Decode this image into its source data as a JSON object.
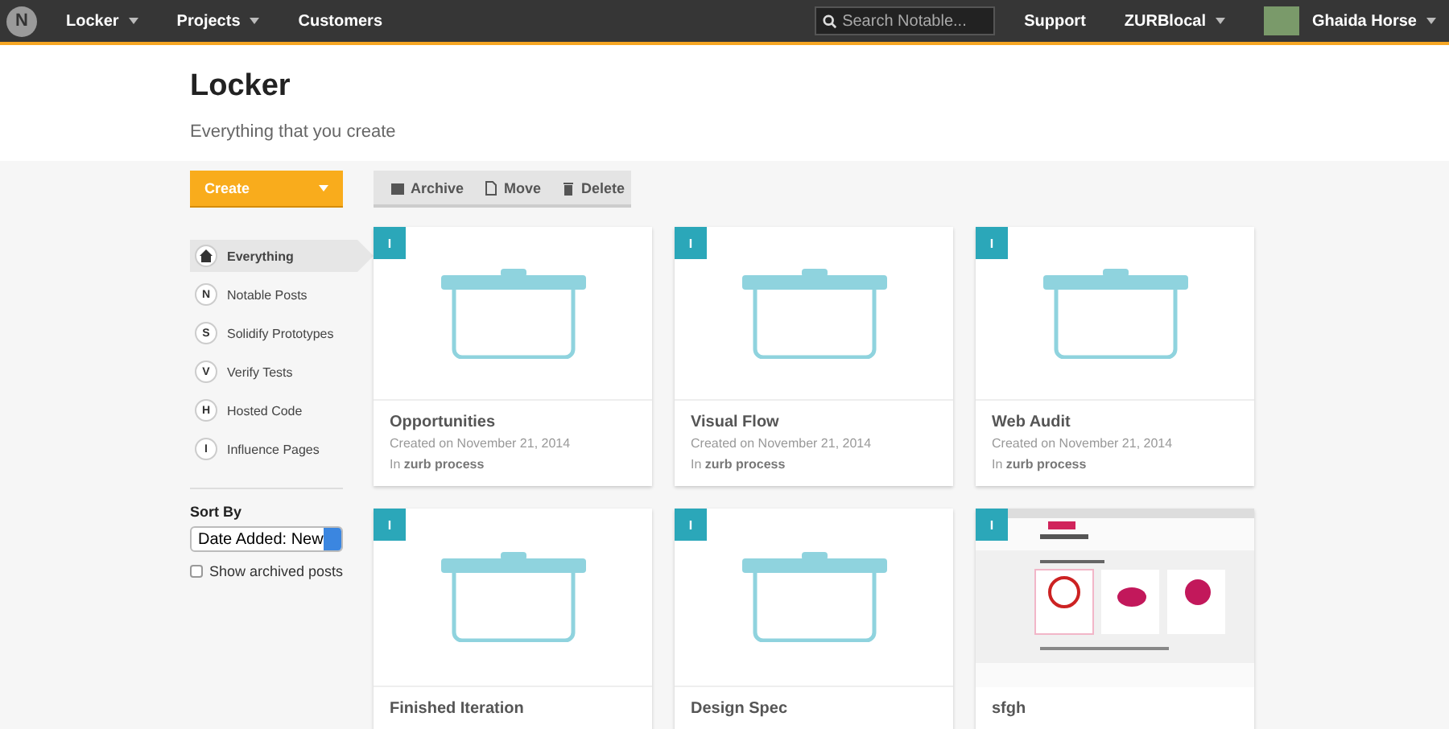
{
  "topbar": {
    "logo": "N",
    "menus": [
      {
        "label": "Locker",
        "dropdown": true
      },
      {
        "label": "Projects",
        "dropdown": true
      },
      {
        "label": "Customers",
        "dropdown": false
      }
    ],
    "search": {
      "placeholder": "Search Notable..."
    },
    "right": [
      {
        "label": "Support",
        "dropdown": false
      },
      {
        "label": "ZURBlocal",
        "dropdown": true
      }
    ],
    "user": {
      "name": "Ghaida Horse",
      "dropdown": true
    }
  },
  "header": {
    "title": "Locker",
    "subtitle": "Everything that you create"
  },
  "create_button": {
    "label": "Create"
  },
  "toolbar": [
    {
      "label": "Archive",
      "kind": "archive"
    },
    {
      "label": "Move",
      "kind": "move"
    },
    {
      "label": "Delete",
      "kind": "delete"
    }
  ],
  "sidebar": {
    "items": [
      {
        "label": "Everything",
        "kind": "home",
        "selected": true
      },
      {
        "label": "Notable Posts",
        "kind": "letter",
        "badge": "N",
        "selected": false
      },
      {
        "label": "Solidify Prototypes",
        "kind": "letter",
        "badge": "S",
        "selected": false
      },
      {
        "label": "Verify Tests",
        "kind": "letter",
        "badge": "V",
        "selected": false
      },
      {
        "label": "Hosted Code",
        "kind": "letter",
        "badge": "H",
        "selected": false
      },
      {
        "label": "Influence Pages",
        "kind": "letter",
        "badge": "I",
        "selected": false
      }
    ],
    "sort_label": "Sort By",
    "sort_value": "Date Added: New",
    "show_archived": {
      "label": "Show archived posts",
      "checked": false
    }
  },
  "cards": [
    {
      "badge": "I",
      "kind": "locker",
      "title": "Opportunities",
      "created": "Created on November 21, 2014",
      "project": "In **zurb process**"
    },
    {
      "badge": "I",
      "kind": "locker",
      "title": "Visual Flow",
      "created": "Created on November 21, 2014",
      "project": "In **zurb process**"
    },
    {
      "badge": "I",
      "kind": "locker",
      "title": "Web Audit",
      "created": "Created on November 21, 2014",
      "project": "In **zurb process**"
    },
    {
      "badge": "I",
      "kind": "locker",
      "title": "Finished Iteration"
    },
    {
      "badge": "I",
      "kind": "locker",
      "title": "Design Spec"
    },
    {
      "badge": "I",
      "kind": "screenshot",
      "title": "sfgh"
    }
  ]
}
